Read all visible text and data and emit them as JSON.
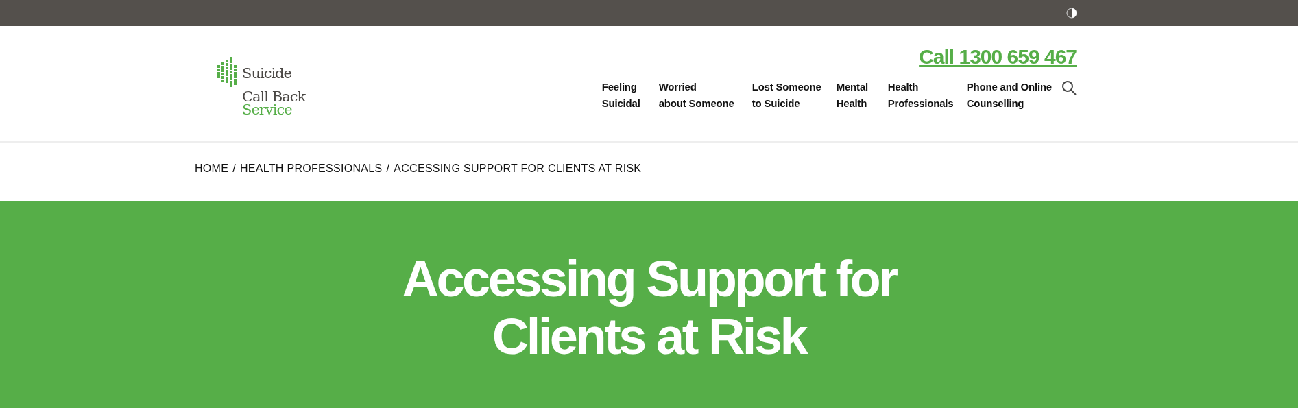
{
  "top_bar": {
    "contrast_toggle": {
      "on": false
    }
  },
  "logo": {
    "lines": [
      "Suicide",
      "Call Back",
      "Service"
    ]
  },
  "phone": "Call 1300 659 467",
  "nav": [
    {
      "lines": [
        "Feeling",
        "Suicidal"
      ]
    },
    {
      "lines": [
        "Worried",
        "about Someone"
      ]
    },
    {
      "lines": [
        "Lost Someone",
        "to Suicide"
      ]
    },
    {
      "lines": [
        "Mental",
        "Health"
      ]
    },
    {
      "lines": [
        "Health",
        "Professionals"
      ]
    },
    {
      "lines": [
        "Phone and Online",
        "Counselling"
      ]
    }
  ],
  "breadcrumb": {
    "separator": "/",
    "items": [
      "HOME",
      "HEALTH PROFESSIONALS",
      "ACCESSING SUPPORT FOR CLIENTS AT RISK"
    ]
  },
  "hero": {
    "title_lines": [
      "Accessing Support for",
      "Clients at Risk"
    ]
  }
}
